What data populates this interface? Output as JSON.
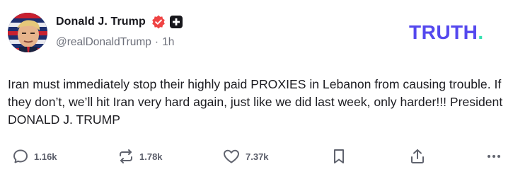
{
  "author": {
    "display_name": "Donald J. Trump",
    "handle": "@realDonaldTrump",
    "separator": "·",
    "time_ago": "1h"
  },
  "brand": {
    "text": "TRUTH",
    "dot": ".",
    "color": "#5448ee",
    "dot_color": "#36e1b1"
  },
  "post": {
    "text": "Iran must immediately stop their highly paid PROXIES in Lebanon from causing trouble. If they don’t, we’ll hit Iran very hard again, just like we did last week, only harder!!! President  DONALD J. TRUMP"
  },
  "actions": {
    "replies": "1.16k",
    "retruths": "1.78k",
    "likes": "7.37k"
  },
  "icons": {
    "verified": "verified-badge-icon",
    "plus": "plus-badge-icon",
    "reply": "speech-bubble-icon",
    "retruth": "repost-arrows-icon",
    "like": "heart-icon",
    "bookmark": "bookmark-icon",
    "share": "share-upload-icon",
    "more": "more-dots-icon"
  },
  "colors": {
    "verified": "#ef4444",
    "icon_gray": "#60636e"
  }
}
